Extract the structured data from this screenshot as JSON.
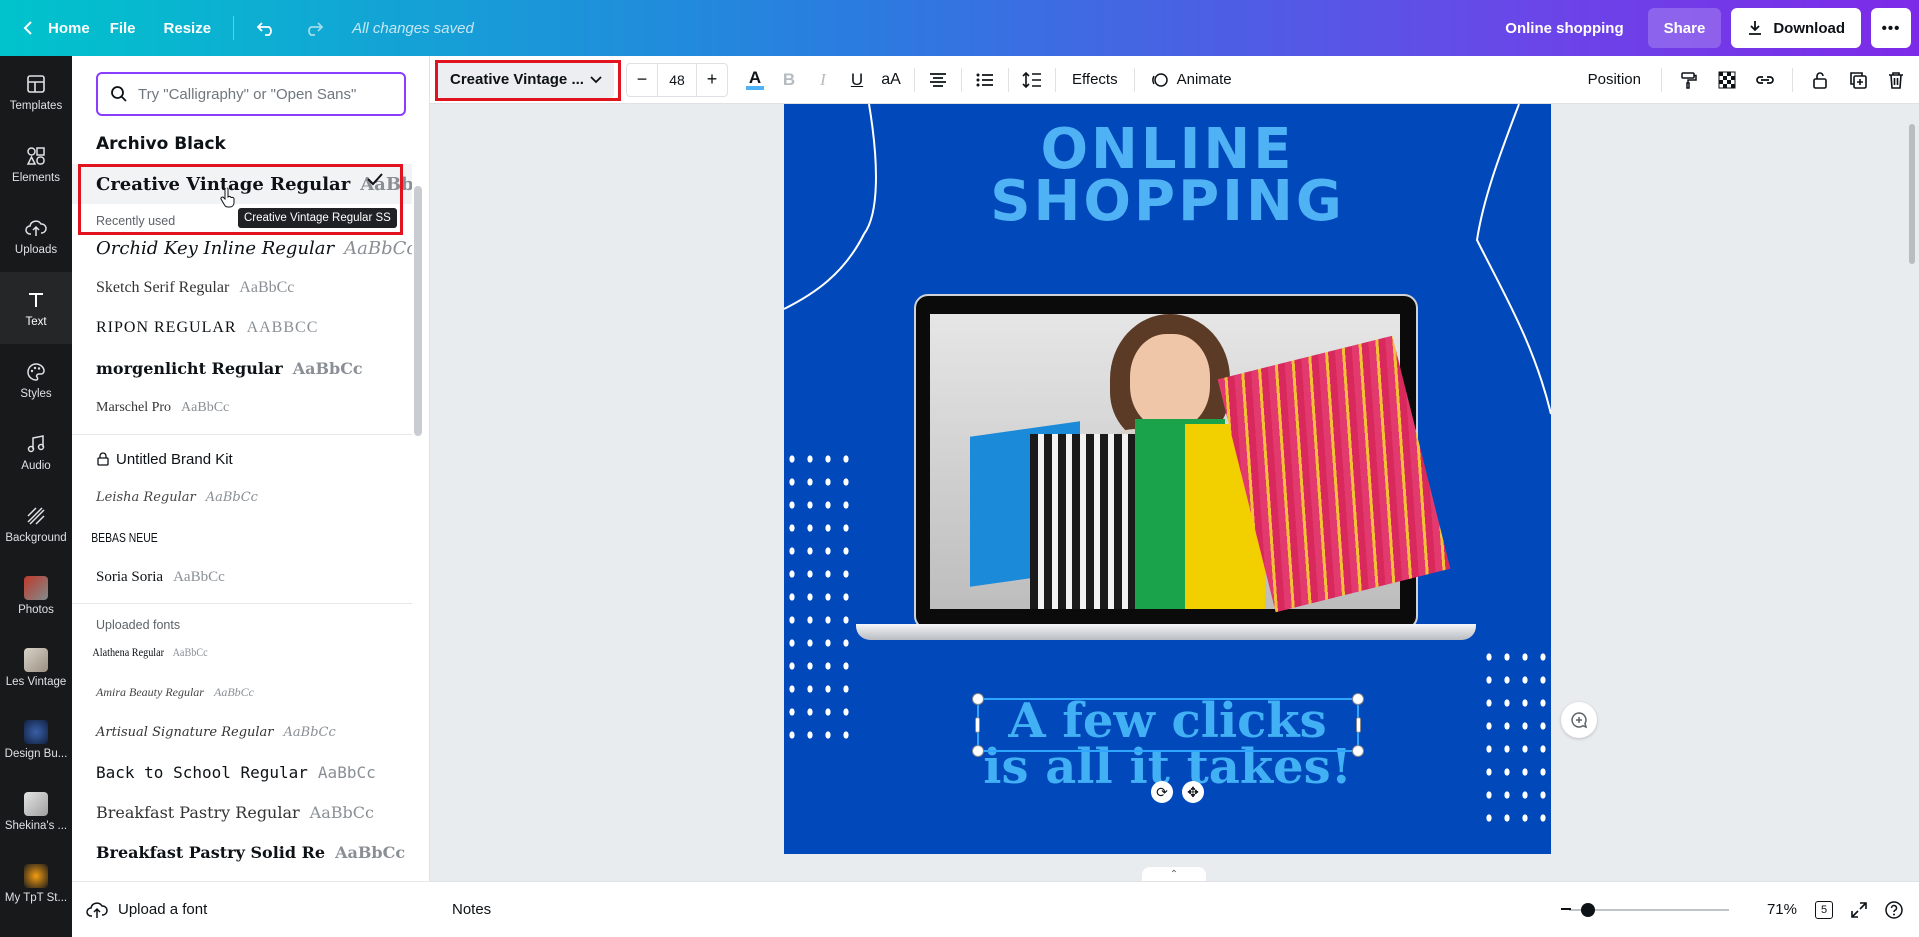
{
  "topbar": {
    "home": "Home",
    "file": "File",
    "resize": "Resize",
    "saved_status": "All changes saved",
    "design_title": "Online shopping",
    "share": "Share",
    "download": "Download"
  },
  "rail": [
    {
      "label": "Templates",
      "icon": "templates-icon"
    },
    {
      "label": "Elements",
      "icon": "elements-icon"
    },
    {
      "label": "Uploads",
      "icon": "upload-cloud-icon"
    },
    {
      "label": "Text",
      "icon": "text-icon"
    },
    {
      "label": "Styles",
      "icon": "palette-icon"
    },
    {
      "label": "Audio",
      "icon": "music-note-icon"
    },
    {
      "label": "Background",
      "icon": "background-pattern-icon"
    },
    {
      "label": "Photos",
      "icon": "photos-thumb"
    },
    {
      "label": "Les Vintage",
      "icon": "folder-thumb"
    },
    {
      "label": "Design Bu...",
      "icon": "folder-thumb"
    },
    {
      "label": "Shekina's ...",
      "icon": "folder-thumb"
    },
    {
      "label": "My TpT St...",
      "icon": "folder-thumb"
    }
  ],
  "font_panel": {
    "search_placeholder": "Try \"Calligraphy\" or \"Open Sans\"",
    "top_fonts": [
      {
        "name": "Archivo Black",
        "sample": ""
      },
      {
        "name": "Creative Vintage Regular",
        "sample": "AaBbCc"
      }
    ],
    "tooltip": "Creative Vintage Regular SS",
    "recently_used_label": "Recently used",
    "recent": [
      {
        "name": "Orchid Key Inline Regular",
        "sample": "AaBbCc"
      },
      {
        "name": "Sketch Serif Regular",
        "sample": "AaBbCc"
      },
      {
        "name": "RIPON REGULAR",
        "sample": "AABBCC"
      },
      {
        "name": "morgenlicht Regular",
        "sample": "AaBbCc"
      },
      {
        "name": "Marschel Pro",
        "sample": "AaBbCc"
      }
    ],
    "brand_kit_label": "Untitled Brand Kit",
    "brand": [
      {
        "name": "Leisha Regular",
        "sample": "AaBbCc"
      },
      {
        "name": "BEBAS NEUE",
        "sample": ""
      },
      {
        "name": "Soria Soria",
        "sample": "AaBbCc"
      }
    ],
    "uploaded_label": "Uploaded fonts",
    "uploaded": [
      {
        "name": "Alathena Regular",
        "sample": "AaBbCc"
      },
      {
        "name": "Amira Beauty Regular",
        "sample": "AaBbCc"
      },
      {
        "name": "Artisual Signature Regular",
        "sample": "AaBbCc"
      },
      {
        "name": "Back to School Regular",
        "sample": "AaBbCc"
      },
      {
        "name": "Breakfast Pastry Regular",
        "sample": "AaBbCc"
      },
      {
        "name": "Breakfast Pastry Solid Re",
        "sample": "AaBbCc"
      }
    ],
    "upload_font": "Upload a font"
  },
  "toolbar": {
    "font_name": "Creative Vintage ...",
    "font_size": "48",
    "effects": "Effects",
    "animate": "Animate",
    "position": "Position"
  },
  "design": {
    "title_line1": "ONLINE",
    "title_line2": "SHOPPING",
    "body_line1": "A few clicks",
    "body_line2": "is all it takes!"
  },
  "bottombar": {
    "notes": "Notes",
    "zoom": "71%",
    "page_count": "5"
  },
  "colors": {
    "design_bg": "#0148ba",
    "title_text": "#4fb2f4",
    "selection": "#e0131f",
    "rail_bg": "#18191b"
  }
}
